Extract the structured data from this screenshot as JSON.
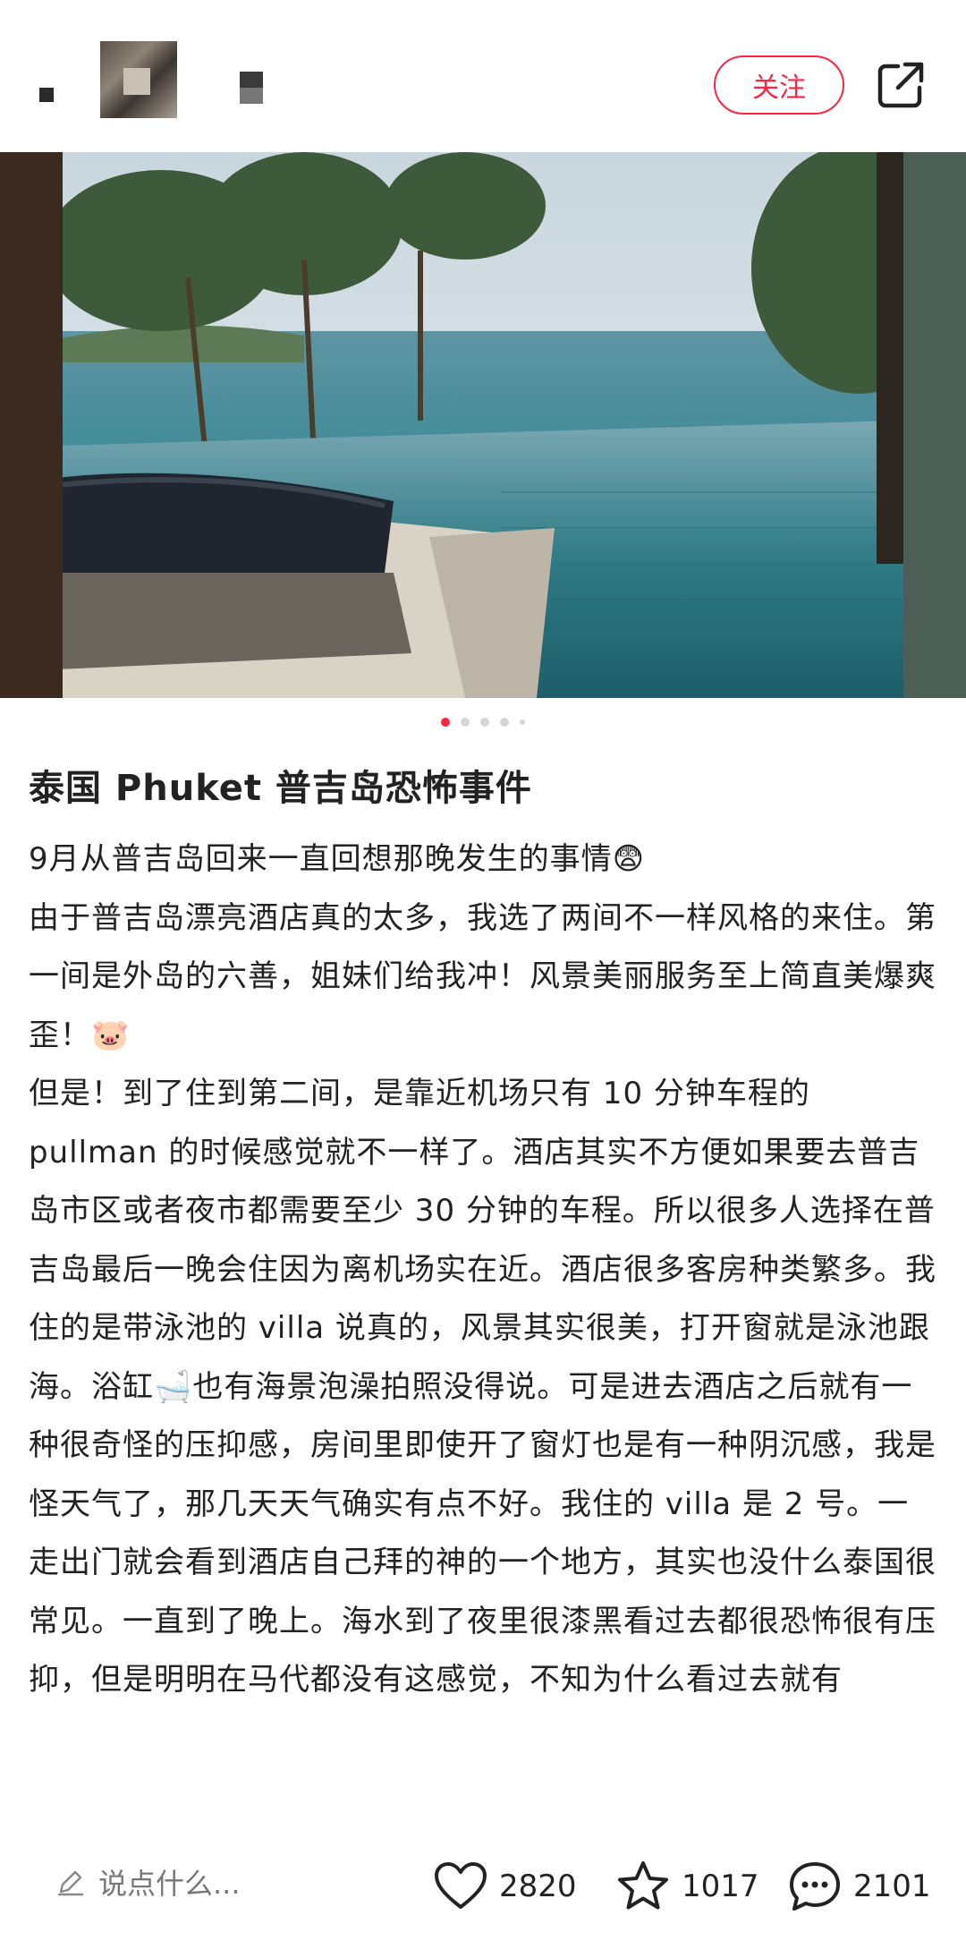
{
  "header": {
    "follow_label": "关注",
    "share_icon": "share-icon"
  },
  "colors": {
    "accent": "#ff2442",
    "text": "#222222",
    "muted": "#777777"
  },
  "carousel": {
    "total": 5,
    "active_index": 0
  },
  "post": {
    "title": "泰国 Phuket 普吉岛恐怖事件",
    "paragraphs": [
      "9月从普吉岛回来一直回想那晚发生的事情😨",
      "由于普吉岛漂亮酒店真的太多，我选了两间不一样风格的来住。第一间是外岛的六善，姐妹们给我冲！风景美丽服务至上简直美爆爽歪！🐷",
      "但是！到了住到第二间，是靠近机场只有 10 分钟车程的 pullman 的时候感觉就不一样了。酒店其实不方便如果要去普吉岛市区或者夜市都需要至少 30 分钟的车程。所以很多人选择在普吉岛最后一晚会住因为离机场实在近。酒店很多客房种类繁多。我住的是带泳池的 villa 说真的，风景其实很美，打开窗就是泳池跟海。浴缸🛁也有海景泡澡拍照没得说。可是进去酒店之后就有一种很奇怪的压抑感，房间里即使开了窗灯也是有一种阴沉感，我是怪天气了，那几天天气确实有点不好。我住的 villa 是 2 号。一走出门就会看到酒店自己拜的神的一个地方，其实也没什么泰国很常见。一直到了晚上。海水到了夜里很漆黑看过去都很恐怖很有压抑，但是明明在马代都没有这感觉，不知为什么看过去就有"
    ]
  },
  "bottom_bar": {
    "comment_placeholder": "说点什么...",
    "likes": "2820",
    "favorites": "1017",
    "comments": "2101"
  }
}
